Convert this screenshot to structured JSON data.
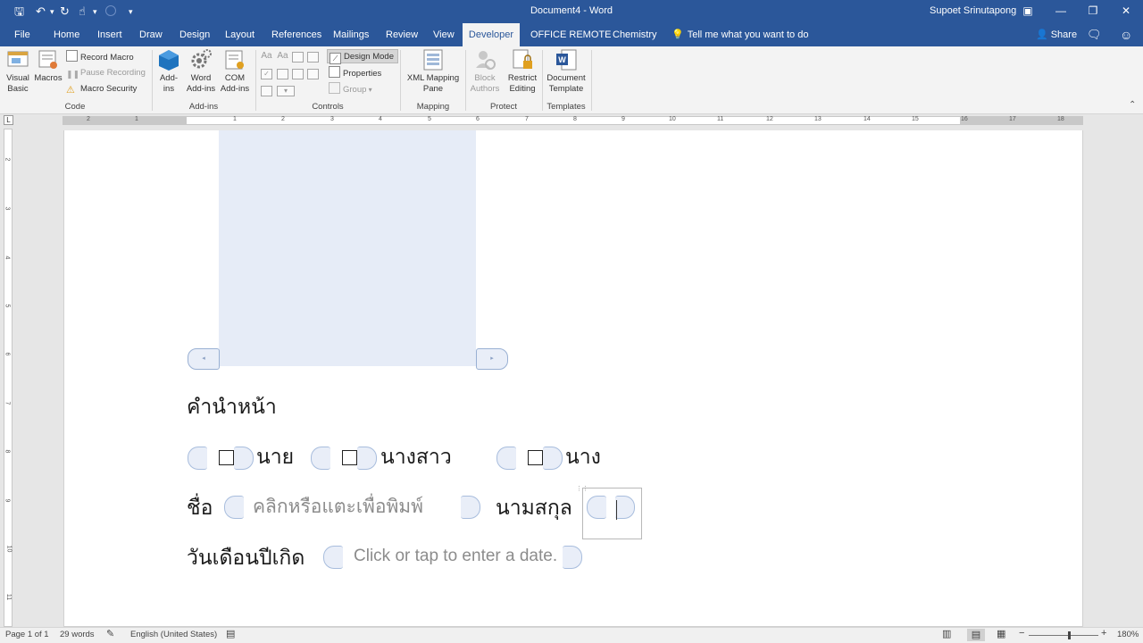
{
  "titlebar": {
    "doc_title": "Document4 - Word",
    "user": "Supoet Srinutapong",
    "save_glyph": "🖫",
    "undo_glyph": "↶",
    "redo_glyph": "↻",
    "touch_glyph": "☝",
    "more_glyph": "▾",
    "min_glyph": "—",
    "restore_glyph": "❐",
    "close_glyph": "✕",
    "ribbon_opt_glyph": "▣"
  },
  "tabs": [
    {
      "label": "File"
    },
    {
      "label": "Home"
    },
    {
      "label": "Insert"
    },
    {
      "label": "Draw"
    },
    {
      "label": "Design"
    },
    {
      "label": "Layout"
    },
    {
      "label": "References"
    },
    {
      "label": "Mailings"
    },
    {
      "label": "Review"
    },
    {
      "label": "View"
    },
    {
      "label": "Developer",
      "active": true
    },
    {
      "label": "OFFICE REMOTE"
    },
    {
      "label": "Chemistry"
    }
  ],
  "tell_me": "Tell me what you want to do",
  "share_label": "Share",
  "ribbon": {
    "code": {
      "label": "Code",
      "visual_basic": "Visual Basic",
      "macros": "Macros",
      "record_macro": "Record Macro",
      "pause_recording": "Pause Recording",
      "macro_security": "Macro Security"
    },
    "addins": {
      "label": "Add-ins",
      "addins": "Add-ins",
      "word_addins": "Word Add-ins",
      "com_addins": "COM Add-ins"
    },
    "controls": {
      "label": "Controls",
      "design_mode": "Design Mode",
      "properties": "Properties",
      "group": "Group"
    },
    "mapping": {
      "label": "Mapping",
      "xml_pane": "XML Mapping Pane"
    },
    "protect": {
      "label": "Protect",
      "block_authors": "Block Authors",
      "restrict_editing": "Restrict Editing"
    },
    "templates": {
      "label": "Templates",
      "document_template": "Document Template"
    }
  },
  "ruler_numbers": [
    "2",
    "1",
    "1",
    "2",
    "3",
    "4",
    "5",
    "6",
    "7",
    "8",
    "9",
    "10",
    "11",
    "12",
    "13",
    "14",
    "15",
    "16",
    "17",
    "18"
  ],
  "vruler_numbers": [
    "2",
    "3",
    "4",
    "5",
    "6",
    "7",
    "8",
    "9",
    "10",
    "11"
  ],
  "document": {
    "heading": "คำนำหน้า",
    "option1": "นาย",
    "option2": "นางสาว",
    "option3": "นาง",
    "checkbox_glyph": "☐",
    "name_label": "ชื่อ",
    "name_placeholder": "คลิกหรือแตะเพื่อพิมพ์",
    "surname_label": "นามสกุล",
    "dob_label": "วันเดือนปีเกิด",
    "date_placeholder": "Click or tap to enter a date."
  },
  "statusbar": {
    "page": "Page 1 of 1",
    "words": "29 words",
    "language": "English (United States)",
    "zoom": "180%",
    "zoom_level": 180
  }
}
